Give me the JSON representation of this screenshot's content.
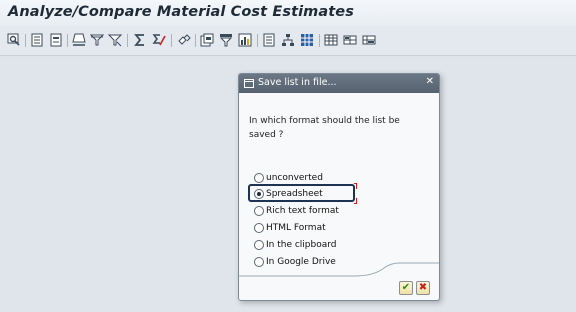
{
  "window": {
    "title": "Analyze/Compare Material Cost Estimates"
  },
  "toolbar": {
    "icons": [
      "search-icon",
      "document-icon",
      "document-icon",
      "print-icon",
      "filter-icon",
      "filter-icon",
      "sum-icon",
      "subtotal-icon",
      "link-icon",
      "export-icon",
      "filter-icon",
      "chart-icon",
      "list-icon",
      "hierarchy-icon",
      "grid-icon",
      "table-icon",
      "layout-icon",
      "layout-icon"
    ]
  },
  "dialog": {
    "title": "Save list in file...",
    "close_glyph": "✕",
    "question": "In which format should the list be saved ?",
    "options": [
      {
        "label": "unconverted",
        "selected": false
      },
      {
        "label": "Spreadsheet",
        "selected": true
      },
      {
        "label": "Rich text format",
        "selected": false
      },
      {
        "label": "HTML Format",
        "selected": false
      },
      {
        "label": "In the clipboard",
        "selected": false
      },
      {
        "label": "In Google Drive",
        "selected": false
      }
    ],
    "confirm_glyph": "✔",
    "cancel_glyph": "✖",
    "colors": {
      "header": "#5f6b78",
      "confirm": "#2e8b1f",
      "cancel": "#c62020",
      "focus": "#1e3354"
    }
  }
}
